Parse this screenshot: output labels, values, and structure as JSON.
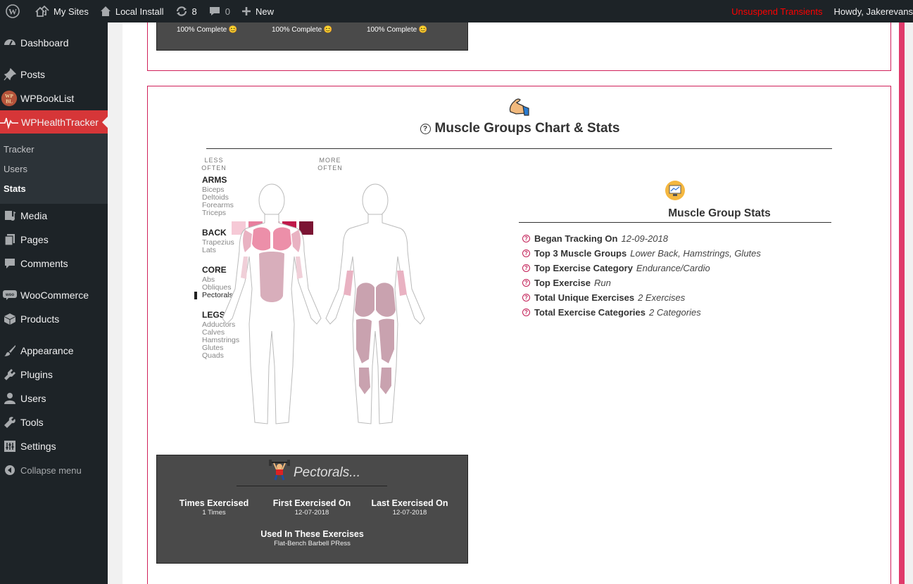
{
  "adminbar": {
    "my_sites": "My Sites",
    "site_name": "Local Install",
    "updates_count": "8",
    "comments_count": "0",
    "new_label": "New",
    "unsuspend": "Unsuspend Transients",
    "howdy": "Howdy, Jakerevans"
  },
  "sidebar": {
    "items": [
      {
        "label": "Dashboard",
        "icon": "dashboard-icon"
      },
      {
        "label": "Posts",
        "icon": "pin-icon"
      },
      {
        "label": "WPBookList",
        "icon": "wpbooklist-logo-icon"
      },
      {
        "label": "WPHealthTracker",
        "icon": "heartbeat-icon"
      },
      {
        "label": "Media",
        "icon": "media-icon"
      },
      {
        "label": "Pages",
        "icon": "pages-icon"
      },
      {
        "label": "Comments",
        "icon": "comment-icon"
      },
      {
        "label": "WooCommerce",
        "icon": "woo-icon"
      },
      {
        "label": "Products",
        "icon": "box-icon"
      },
      {
        "label": "Appearance",
        "icon": "brush-icon"
      },
      {
        "label": "Plugins",
        "icon": "plug-icon"
      },
      {
        "label": "Users",
        "icon": "user-icon"
      },
      {
        "label": "Tools",
        "icon": "wrench-icon"
      },
      {
        "label": "Settings",
        "icon": "settings-icon"
      }
    ],
    "submenu": [
      "Tracker",
      "Users",
      "Stats"
    ],
    "collapse": "Collapse menu"
  },
  "top_box": {
    "complete": [
      "100% Complete 😊",
      "100% Complete 😊",
      "100% Complete 😊"
    ]
  },
  "muscle": {
    "title": "Muscle Groups Chart & Stats",
    "legend_less": [
      "LESS",
      "OFTEN"
    ],
    "legend_more": [
      "MORE",
      "OFTEN"
    ],
    "legend_colors": [
      "#f6c9d6",
      "#e77f9e",
      "#d94a73",
      "#c0194a",
      "#7b1433"
    ],
    "groups": [
      {
        "name": "ARMS",
        "items": [
          "Biceps",
          "Deltoids",
          "Forearms",
          "Triceps"
        ]
      },
      {
        "name": "BACK",
        "items": [
          "Trapezius",
          "Lats"
        ]
      },
      {
        "name": "CORE",
        "items": [
          "Abs",
          "Obliques",
          "Pectorals"
        ]
      },
      {
        "name": "LEGS",
        "items": [
          "Adductors",
          "Calves",
          "Hamstrings",
          "Glutes",
          "Quads"
        ]
      }
    ],
    "stats_title": "Muscle Group Stats",
    "stats": [
      {
        "label": "Began Tracking On",
        "value": "12-09-2018"
      },
      {
        "label": "Top 3 Muscle Groups",
        "value": "Lower Back, Hamstrings, Glutes"
      },
      {
        "label": "Top Exercise Category",
        "value": "Endurance/Cardio"
      },
      {
        "label": "Top Exercise",
        "value": "Run"
      },
      {
        "label": "Total Unique Exercises",
        "value": "2 Exercises"
      },
      {
        "label": "Total Exercise Categories",
        "value": "2 Categories"
      }
    ]
  },
  "detail": {
    "title": "Pectorals...",
    "times_label": "Times Exercised",
    "times_value": "1 Times",
    "first_label": "First Exercised On",
    "first_value": "12-07-2018",
    "last_label": "Last Exercised On",
    "last_value": "12-07-2018",
    "used_label": "Used In These Exercises",
    "used_value": "Flat-Bench Barbell PRess"
  }
}
